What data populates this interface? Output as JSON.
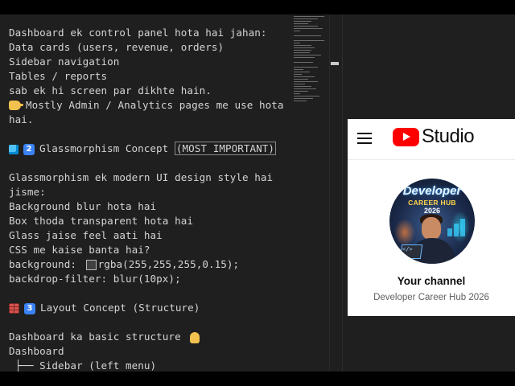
{
  "editor": {
    "lines": [
      {
        "text": "Dashboard ek control panel hota hai jahan:"
      },
      {
        "text": "Data cards (users, revenue, orders)"
      },
      {
        "text": "Sidebar navigation"
      },
      {
        "text": "Tables / reports"
      },
      {
        "text": "sab ek hi screen par dikhte hain."
      },
      {
        "emoji": "pointing-hand-icon",
        "text": "Mostly Admin / Analytics pages me use hota"
      },
      {
        "text": "hai."
      },
      {
        "text": ""
      },
      {
        "emoji": "cube-icon",
        "badge": "2",
        "text": "Glassmorphism Concept ",
        "highlight": "(MOST IMPORTANT)"
      },
      {
        "text": ""
      },
      {
        "text": "Glassmorphism ek modern UI design style hai"
      },
      {
        "text": "jisme:"
      },
      {
        "text": "Background blur hota hai"
      },
      {
        "text": "Box thoda transparent hota hai"
      },
      {
        "text": "Glass jaise feel aati hai"
      },
      {
        "text": "CSS me kaise banta hai?"
      },
      {
        "text": "background: ",
        "swatch": true,
        "after": "rgba(255,255,255,0.15);"
      },
      {
        "text": "backdrop-filter: blur(10px);"
      },
      {
        "text": ""
      },
      {
        "emoji": "brick-icon",
        "badge": "3",
        "text": "Layout Concept (Structure)"
      },
      {
        "text": ""
      },
      {
        "text": "Dashboard ka basic structure ",
        "trailing_emoji": "pointing-down-icon"
      },
      {
        "text": "Dashboard"
      },
      {
        "text": " ├── Sidebar (left menu)"
      }
    ]
  },
  "studio": {
    "logo_text": "Studio",
    "avatar": {
      "line1": "Developer",
      "line2": "CAREER HUB",
      "line3": "2026",
      "code_symbol": "</>"
    },
    "channel_label": "Your channel",
    "channel_name": "Developer Career Hub 2026"
  },
  "colors": {
    "editor_bg": "#1f1f1f",
    "editor_text": "#d4d4d4",
    "youtube_red": "#ff0000",
    "card_bg": "#ffffff",
    "secondary_text": "#606060"
  }
}
